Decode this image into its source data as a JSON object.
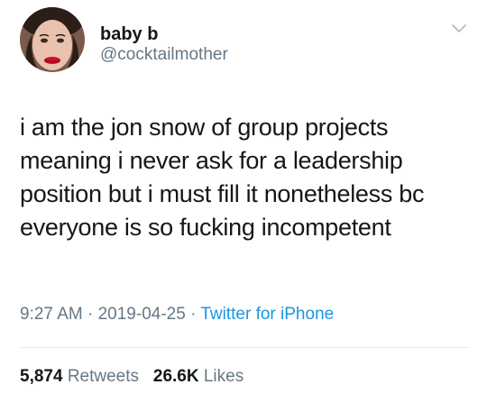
{
  "author": {
    "name": "baby b",
    "handle": "@cocktailmother"
  },
  "tweet": {
    "lines": [
      "i am the jon snow of group projects",
      "meaning i never ask for a leadership",
      "position but i must fill it nonetheless bc",
      "everyone is so fucking incompetent"
    ]
  },
  "meta": {
    "time": "9:27 AM",
    "date": "2019-04-25",
    "separator": "·",
    "source": "Twitter for iPhone"
  },
  "stats": {
    "retweets_count": "5,874",
    "retweets_label": "Retweets",
    "likes_count": "26.6K",
    "likes_label": "Likes"
  },
  "icons": {
    "menu": "chevron-down-icon"
  },
  "colors": {
    "text": "#14171a",
    "secondary": "#657786",
    "link": "#1b95e0",
    "divider": "#e6ecf0"
  }
}
